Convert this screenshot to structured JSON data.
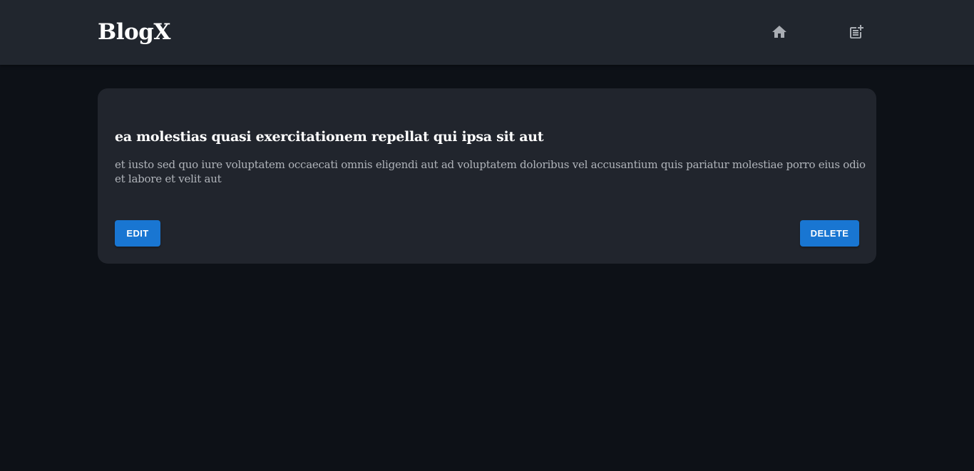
{
  "app": {
    "brand": "BlogX"
  },
  "nav": {
    "home_icon": "home-icon",
    "new_post_icon": "post-add-icon"
  },
  "post": {
    "title": "ea molestias quasi exercitationem repellat qui ipsa sit aut",
    "body": "et iusto sed quo iure voluptatem occaecati omnis eligendi aut ad voluptatem doloribus vel accusantium quis pariatur molestiae porro eius odio et labore et velit aut",
    "edit_label": "EDIT",
    "delete_label": "DELETE"
  },
  "colors": {
    "background": "#0d1117",
    "app_bar": "#21262e",
    "card": "#21252d",
    "primary_button": "#1976d2",
    "body_text": "#b0b4ba",
    "icon": "#a9adb3"
  }
}
